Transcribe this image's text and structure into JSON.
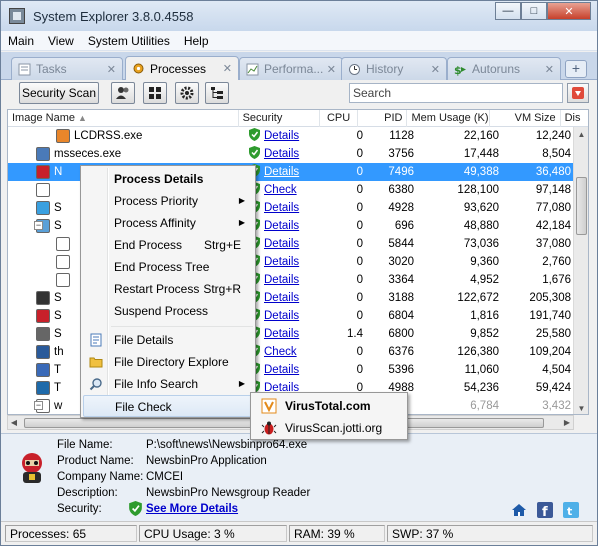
{
  "window": {
    "title": "System Explorer 3.8.0.4558"
  },
  "menu": [
    "Main",
    "View",
    "System Utilities",
    "Help"
  ],
  "tabs": [
    {
      "label": "Tasks",
      "icon": "tasks-icon",
      "active": false
    },
    {
      "label": "Processes",
      "icon": "processes-gear-icon",
      "active": true
    },
    {
      "label": "Performa...",
      "icon": "performance-icon",
      "active": false
    },
    {
      "label": "History",
      "icon": "clock-icon",
      "active": false
    },
    {
      "label": "Autoruns",
      "icon": "autoruns-icon",
      "active": false
    }
  ],
  "toolbar": {
    "security_scan": "Security Scan",
    "search_placeholder": "Search"
  },
  "columns": [
    "Image Name",
    "Security",
    "CPU",
    "PID",
    "Mem Usage (K)",
    "VM Size",
    "Dis"
  ],
  "rows": [
    {
      "name": "LCDRSS.exe",
      "security": "Details",
      "cpu": "0",
      "pid": "1128",
      "mem": "22,160",
      "vm": "12,240"
    },
    {
      "name": "msseces.exe",
      "security": "Details",
      "cpu": "0",
      "pid": "3756",
      "mem": "17,448",
      "vm": "8,504"
    },
    {
      "name": "N",
      "security": "Details",
      "cpu": "0",
      "pid": "7496",
      "mem": "49,388",
      "vm": "36,480",
      "selected": true
    },
    {
      "name": "",
      "security": "Check",
      "cpu": "0",
      "pid": "6380",
      "mem": "128,100",
      "vm": "97,148"
    },
    {
      "name": "S",
      "security": "Details",
      "cpu": "0",
      "pid": "4928",
      "mem": "93,620",
      "vm": "77,080"
    },
    {
      "name": "S",
      "security": "Details",
      "cpu": "0",
      "pid": "696",
      "mem": "48,880",
      "vm": "42,184"
    },
    {
      "name": "",
      "security": "Details",
      "cpu": "0",
      "pid": "5844",
      "mem": "73,036",
      "vm": "37,080"
    },
    {
      "name": "",
      "security": "Details",
      "cpu": "0",
      "pid": "3020",
      "mem": "9,360",
      "vm": "2,760"
    },
    {
      "name": "",
      "security": "Details",
      "cpu": "0",
      "pid": "3364",
      "mem": "4,952",
      "vm": "1,676"
    },
    {
      "name": "S",
      "security": "Details",
      "cpu": "0",
      "pid": "3188",
      "mem": "122,672",
      "vm": "205,308"
    },
    {
      "name": "S",
      "security": "Details",
      "cpu": "0",
      "pid": "6804",
      "mem": "1,816",
      "vm": "191,740"
    },
    {
      "name": "S",
      "security": "Details",
      "cpu": "1.4",
      "pid": "6800",
      "mem": "9,852",
      "vm": "25,580"
    },
    {
      "name": "th",
      "security": "Check",
      "cpu": "0",
      "pid": "6376",
      "mem": "126,380",
      "vm": "109,204"
    },
    {
      "name": "T",
      "security": "Details",
      "cpu": "0",
      "pid": "5396",
      "mem": "11,060",
      "vm": "4,504"
    },
    {
      "name": "T",
      "security": "Details",
      "cpu": "0",
      "pid": "4988",
      "mem": "54,236",
      "vm": "59,424"
    },
    {
      "name": "w",
      "security": "",
      "cpu": "",
      "pid": "",
      "mem": "6,784",
      "vm": "3,432"
    }
  ],
  "context_menu": [
    {
      "label": "Process Details",
      "bold": true
    },
    {
      "label": "Process Priority",
      "submenu": true
    },
    {
      "label": "Process Affinity",
      "submenu": true
    },
    {
      "label": "End Process",
      "shortcut": "Strg+E"
    },
    {
      "label": "End Process Tree"
    },
    {
      "label": "Restart Process",
      "shortcut": "Strg+R"
    },
    {
      "label": "Suspend Process"
    },
    {
      "label": "File Details",
      "icon": "file-details-icon"
    },
    {
      "label": "File Directory Explore",
      "icon": "folder-icon"
    },
    {
      "label": "File Info Search",
      "icon": "magnifier-icon",
      "submenu": true
    },
    {
      "label": "File Check",
      "hover": true
    }
  ],
  "submenu": [
    {
      "label": "VirusTotal.com",
      "bold": true,
      "icon": "virustotal-icon"
    },
    {
      "label": "VirusScan.jotti.org",
      "icon": "jotti-bug-icon"
    }
  ],
  "details": {
    "file_name_label": "File Name:",
    "file_name": "P:\\soft\\news\\Newsbinpro64.exe",
    "product_name_label": "Product Name:",
    "product_name": "NewsbinPro Application",
    "company_name_label": "Company Name:",
    "company_name": "CMCEI",
    "description_label": "Description:",
    "description": "NewsbinPro Newsgroup Reader",
    "security_label": "Security:",
    "security_link": "See More Details"
  },
  "status": {
    "processes": "Processes: 65",
    "cpu": "CPU Usage: 3 %",
    "ram": "RAM: 39 %",
    "swp": "SWP: 37 %"
  },
  "colors": {
    "selection": "#3399ff",
    "link": "#0000cc",
    "shield_green": "#2e9b2e"
  }
}
